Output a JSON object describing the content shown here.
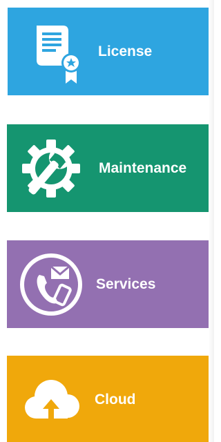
{
  "tiles": [
    {
      "label": "License",
      "icon": "certificate-icon",
      "color": "#2ea5e0"
    },
    {
      "label": "Maintenance",
      "icon": "gear-wrench-icon",
      "color": "#159570"
    },
    {
      "label": "Services",
      "icon": "contact-phone-mail-icon",
      "color": "#9370b1"
    },
    {
      "label": "Cloud",
      "icon": "cloud-upload-icon",
      "color": "#f0a80b"
    }
  ]
}
